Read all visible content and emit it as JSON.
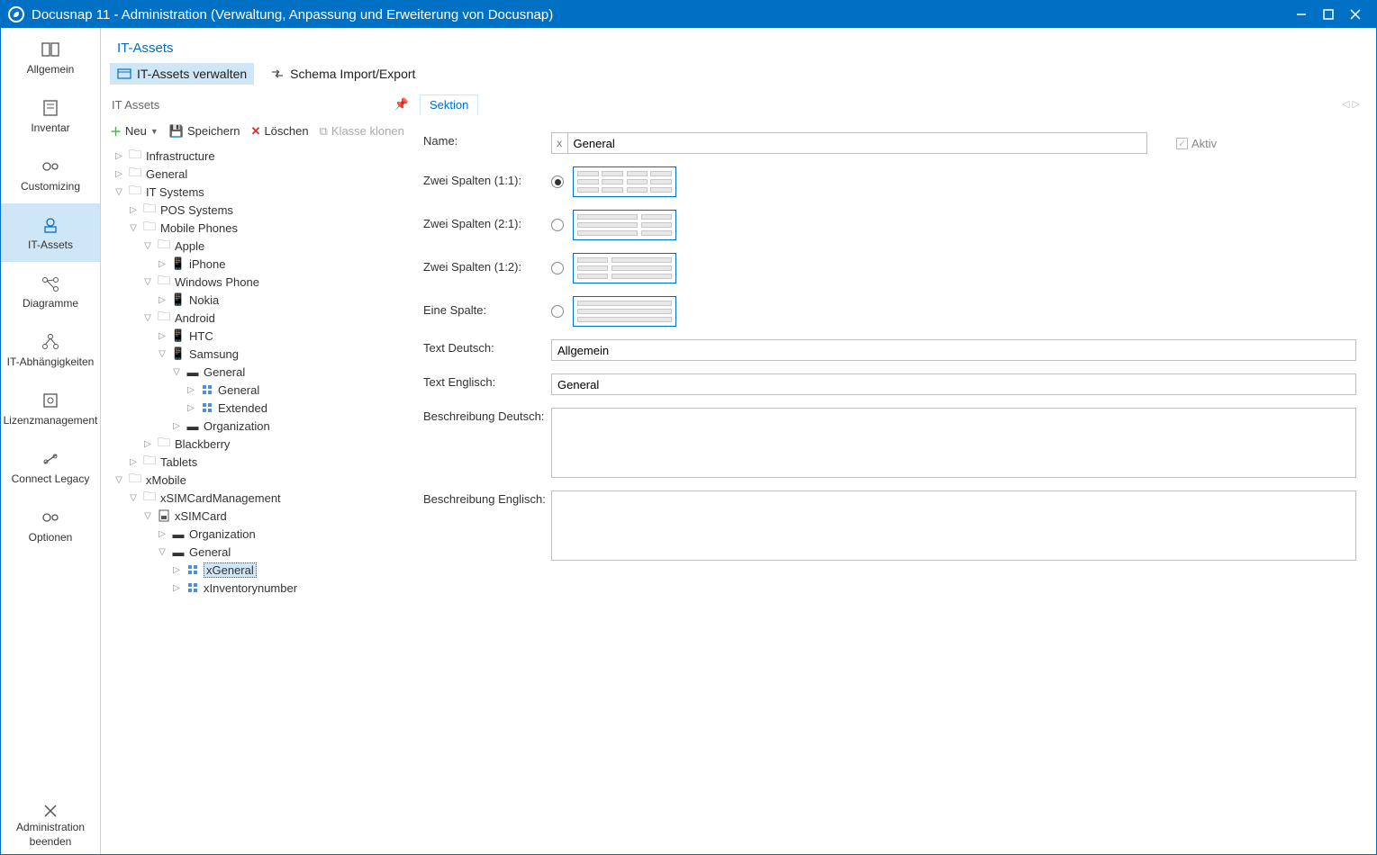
{
  "window": {
    "title": "Docusnap 11 - Administration (Verwaltung, Anpassung und Erweiterung von Docusnap)"
  },
  "sidebar": {
    "items": [
      {
        "label": "Allgemein"
      },
      {
        "label": "Inventar"
      },
      {
        "label": "Customizing"
      },
      {
        "label": "IT-Assets"
      },
      {
        "label": "Diagramme"
      },
      {
        "label": "IT-Abhängigkeiten"
      },
      {
        "label": "Lizenzmanagement"
      },
      {
        "label": "Connect Legacy"
      },
      {
        "label": "Optionen"
      }
    ],
    "exit": {
      "line1": "Administration",
      "line2": "beenden"
    }
  },
  "header": {
    "title": "IT-Assets"
  },
  "tabs": [
    {
      "label": "IT-Assets verwalten"
    },
    {
      "label": "Schema Import/Export"
    }
  ],
  "treehead": "IT Assets",
  "toolbar": {
    "neu": "Neu",
    "speichern": "Speichern",
    "loeschen": "Löschen",
    "klon": "Klasse klonen"
  },
  "tree": {
    "infrastructure": "Infrastructure",
    "general": "General",
    "itsystems": "IT Systems",
    "pos": "POS Systems",
    "mobile": "Mobile Phones",
    "apple": "Apple",
    "iphone": "iPhone",
    "winphone": "Windows Phone",
    "nokia": "Nokia",
    "android": "Android",
    "htc": "HTC",
    "samsung": "Samsung",
    "sgeneral": "General",
    "sgeneral2": "General",
    "sextended": "Extended",
    "sorg": "Organization",
    "blackberry": "Blackberry",
    "tablets": "Tablets",
    "xmobile": "xMobile",
    "xsimmgmt": "xSIMCardManagement",
    "xsim": "xSIMCard",
    "xorg": "Organization",
    "xgen": "General",
    "xgeneral": "xGeneral",
    "xinv": "xInventorynumber"
  },
  "form": {
    "tab": "Sektion",
    "name_label": "Name:",
    "name_value": "General",
    "aktiv": "Aktiv",
    "r1": "Zwei Spalten (1:1):",
    "r2": "Zwei Spalten (2:1):",
    "r3": "Zwei Spalten (1:2):",
    "r4": "Eine Spalte:",
    "td_label": "Text Deutsch:",
    "td_value": "Allgemein",
    "te_label": "Text Englisch:",
    "te_value": "General",
    "bd_label": "Beschreibung Deutsch:",
    "bd_value": "",
    "be_label": "Beschreibung Englisch:",
    "be_value": ""
  }
}
